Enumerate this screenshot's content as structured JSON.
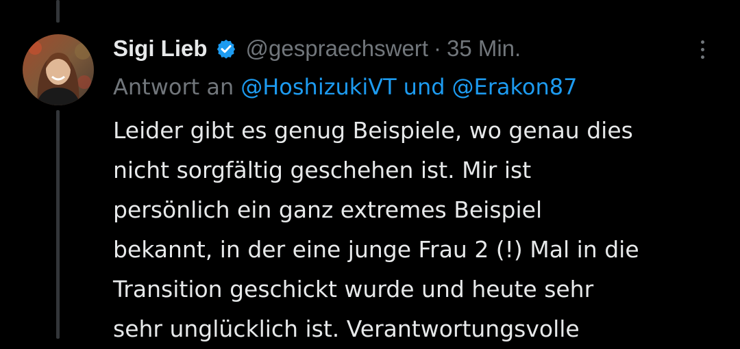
{
  "tweet": {
    "author_name": "Sigi Lieb",
    "handle": "@gespraechswert",
    "separator": "·",
    "timestamp": "35 Min.",
    "verified_icon": "verified-badge-icon",
    "more_icon": "more-vertical-icon",
    "reply_prefix": "Antwort an",
    "reply_mentions": [
      "@HoshizukiVT",
      "@Erakon87"
    ],
    "reply_conjunction": "und",
    "text_lines": [
      "Leider gibt es genug Beispiele, wo genau dies",
      "nicht sorgfältig geschehen ist. Mir ist",
      "persönlich ein ganz extremes Beispiel",
      "bekannt, in der eine junge Frau 2 (!) Mal in die",
      "Transition geschickt wurde und heute sehr",
      "sehr unglücklich ist. Verantwortungsvolle"
    ]
  },
  "colors": {
    "background": "#000000",
    "text_primary": "#e7e9ea",
    "text_secondary": "#71767b",
    "link": "#1d9bf0",
    "thread_line": "#333639"
  }
}
